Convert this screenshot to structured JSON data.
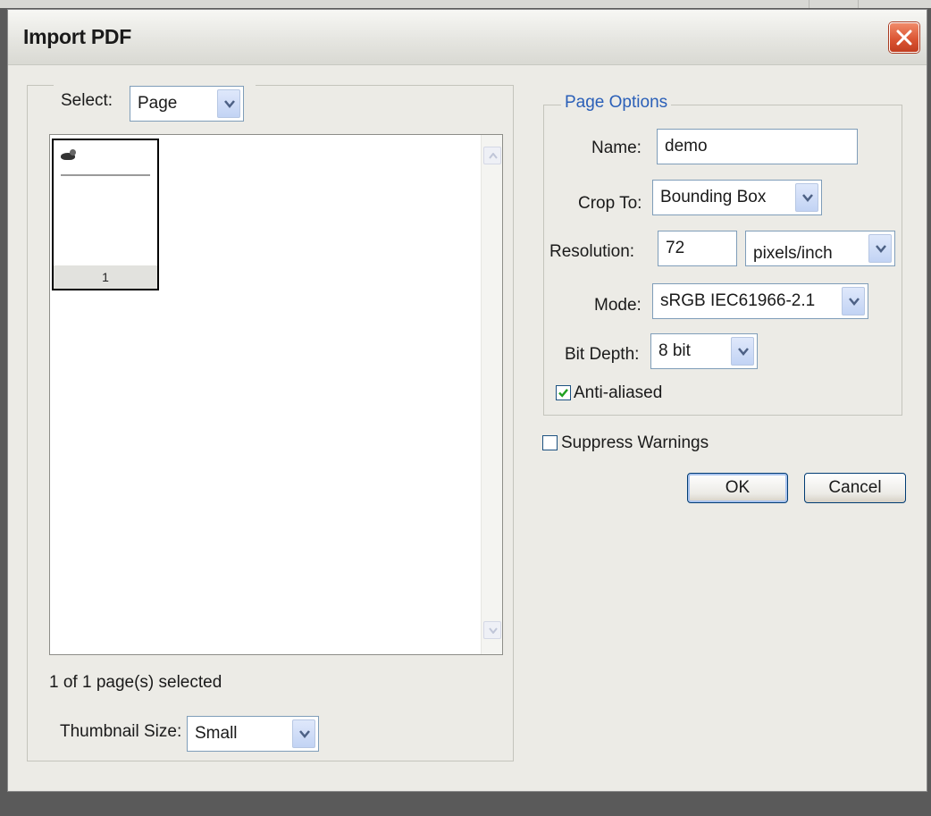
{
  "window": {
    "title": "Import PDF"
  },
  "select": {
    "label": "Select:",
    "value": "Page"
  },
  "thumbnails": {
    "items": [
      {
        "page_number": "1"
      }
    ],
    "status": "1 of 1 page(s) selected",
    "size_label": "Thumbnail Size:",
    "size_value": "Small"
  },
  "page_options": {
    "legend": "Page Options",
    "name_label": "Name:",
    "name_value": "demo",
    "crop_label": "Crop To:",
    "crop_value": "Bounding Box",
    "resolution_label": "Resolution:",
    "resolution_value": "72",
    "resolution_unit": "pixels/inch",
    "mode_label": "Mode:",
    "mode_value": "sRGB IEC61966-2.1",
    "bitdepth_label": "Bit Depth:",
    "bitdepth_value": "8 bit",
    "antialias_label": "Anti-aliased",
    "antialias_checked": true
  },
  "suppress": {
    "label": "Suppress Warnings",
    "checked": false
  },
  "buttons": {
    "ok": "OK",
    "cancel": "Cancel"
  },
  "colors": {
    "accent": "#2a5fb8",
    "close_button": "#dc5634",
    "field_border": "#7f9db9",
    "dialog_bg": "#ecebe6"
  }
}
